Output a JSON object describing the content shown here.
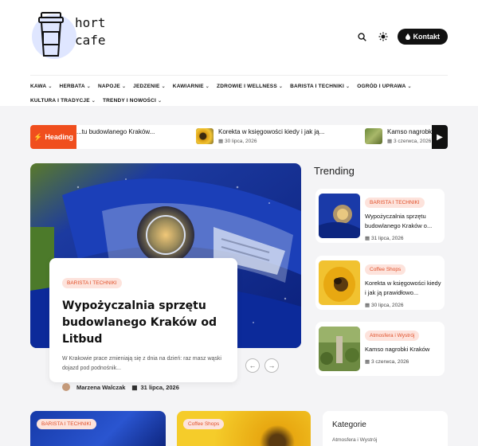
{
  "brand": {
    "line1": "hort",
    "line2": "cafe"
  },
  "header": {
    "search_icon": "search-icon",
    "theme_icon": "sun-icon",
    "contact_label": "Kontakt"
  },
  "nav": [
    "KAWA",
    "HERBATA",
    "NAPOJE",
    "JEDZENIE",
    "KAWIARNIE",
    "ZDROWIE I WELLNESS",
    "BARISTA I TECHNIKI",
    "OGRÓD I UPRAWA",
    "KULTURA I TRADYCJE",
    "TRENDY I NOWOŚCI"
  ],
  "ticker": {
    "label": "Heading",
    "items": [
      {
        "title": "...tu budowlanego Kraków...",
        "date": ""
      },
      {
        "title": "Korekta w księgowości kiedy i jak ją...",
        "date": "30 lipca, 2026"
      },
      {
        "title": "Kamso nagrobki Kraków",
        "date": "3 czerwca, 2026"
      }
    ]
  },
  "hero": {
    "badge": "BARISTA I TECHNIKI",
    "title": "Wypożyczalnia sprzętu budowlanego Kraków od Litbud",
    "excerpt": "W Krakowie prace zmieniają się z dnia na dzień: raz masz wąski dojazd pod podnośnik...",
    "author": "Marzena Walczak",
    "date": "31 lipca, 2026"
  },
  "trending": {
    "heading": "Trending",
    "items": [
      {
        "badge": "BARISTA I TECHNIKI",
        "title": "Wypożyczalnia sprzętu budowlanego Kraków o...",
        "date": "31 lipca, 2026",
        "thumb": "car"
      },
      {
        "badge": "Coffee Shops",
        "title": "Korekta w księgowości kiedy i jak ją prawidłowo...",
        "date": "30 lipca, 2026",
        "thumb": "bee"
      },
      {
        "badge": "Atmosfera i Wystrój",
        "title": "Kamso nagrobki Kraków",
        "date": "3 czerwca, 2026",
        "thumb": "garden"
      }
    ]
  },
  "bottom": {
    "cards": [
      {
        "badge": "BARISTA I TECHNIKI"
      },
      {
        "badge": "Coffee Shops"
      }
    ],
    "categories": {
      "title": "Kategorie",
      "first": "Atmosfera i Wystrój"
    }
  },
  "colors": {
    "accent": "#f04e1d",
    "badge_bg": "#fde3dc",
    "dark": "#111111",
    "band": "#f4f4f6"
  }
}
